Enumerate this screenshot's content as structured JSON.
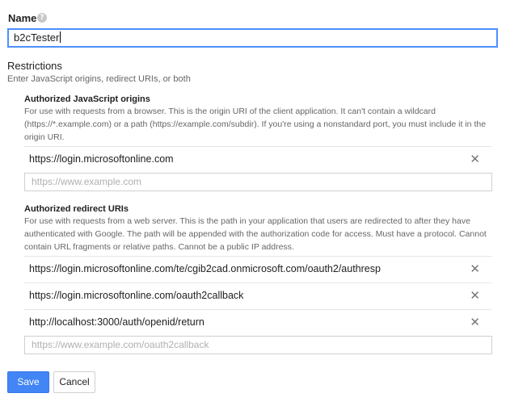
{
  "name": {
    "label": "Name",
    "help_icon": "help-circle-icon",
    "value": "b2cTester"
  },
  "restrictions": {
    "title": "Restrictions",
    "description": "Enter JavaScript origins, redirect URIs, or both"
  },
  "js_origins": {
    "title": "Authorized JavaScript origins",
    "description": "For use with requests from a browser. This is the origin URI of the client application. It can't contain a wildcard (https://*.example.com) or a path (https://example.com/subdir). If you're using a nonstandard port, you must include it in the origin URI.",
    "items": [
      "https://login.microsoftonline.com"
    ],
    "placeholder": "https://www.example.com"
  },
  "redirect_uris": {
    "title": "Authorized redirect URIs",
    "description": "For use with requests from a web server. This is the path in your application that users are redirected to after they have authenticated with Google. The path will be appended with the authorization code for access. Must have a protocol. Cannot contain URL fragments or relative paths. Cannot be a public IP address.",
    "items": [
      "https://login.microsoftonline.com/te/cgib2cad.onmicrosoft.com/oauth2/authresp",
      "https://login.microsoftonline.com/oauth2callback",
      "http://localhost:3000/auth/openid/return"
    ],
    "placeholder": "https://www.example.com/oauth2callback"
  },
  "actions": {
    "save_label": "Save",
    "cancel_label": "Cancel"
  },
  "colors": {
    "primary": "#4285f4",
    "focus_border": "#4d90fe"
  }
}
